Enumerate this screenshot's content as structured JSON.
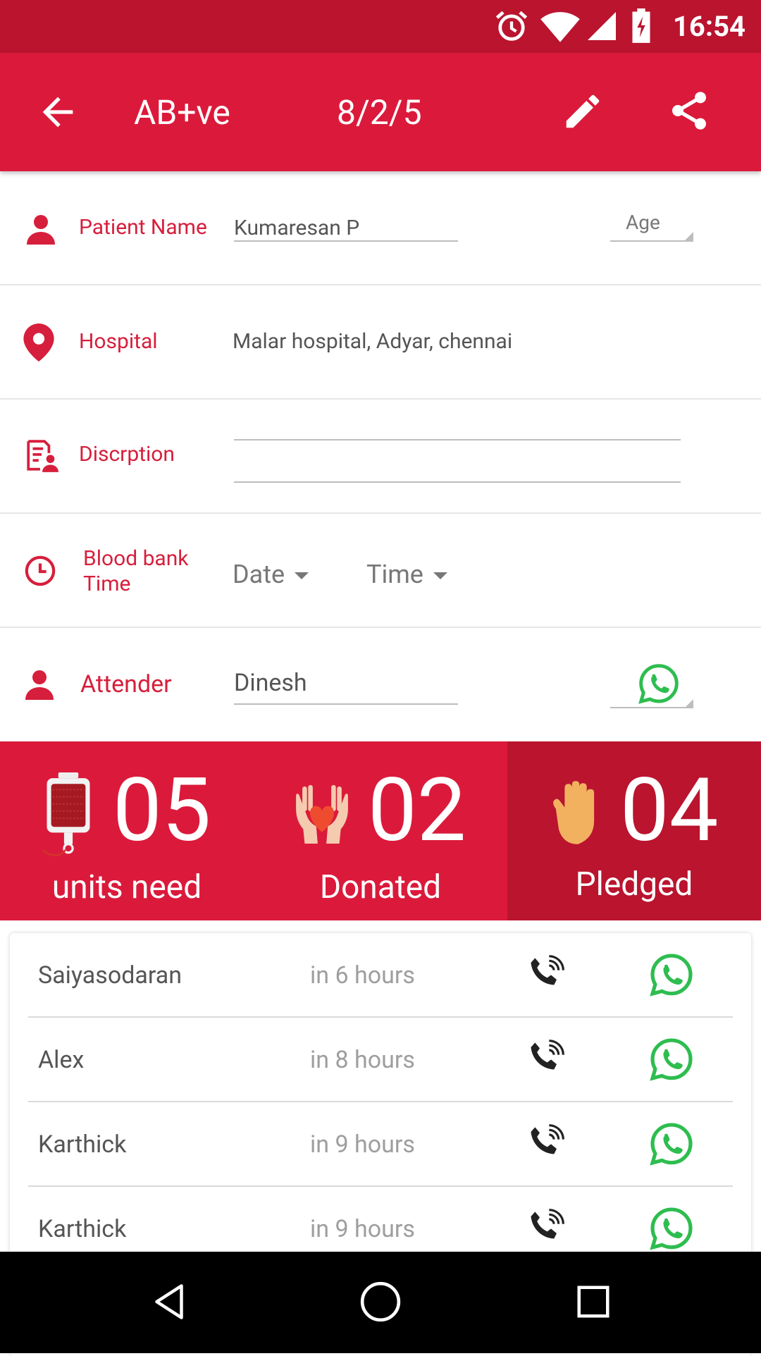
{
  "status_bar": {
    "time": "16:54"
  },
  "app_bar": {
    "title": "AB+ve",
    "subtitle": "8/2/5"
  },
  "form": {
    "patient": {
      "label": "Patient Name",
      "value": "Kumaresan P",
      "age_label": "Age"
    },
    "hospital": {
      "label": "Hospital",
      "value": "Malar hospital, Adyar, chennai"
    },
    "description": {
      "label": "Discrption",
      "value": ""
    },
    "blood_bank": {
      "label_line1": "Blood bank",
      "label_line2": "Time",
      "date_label": "Date",
      "time_label": "Time"
    },
    "attender": {
      "label": "Attender",
      "value": "Dinesh"
    }
  },
  "stats": {
    "needed": {
      "count": "05",
      "label": "units need"
    },
    "donated": {
      "count": "02",
      "label": "Donated"
    },
    "pledged": {
      "count": "04",
      "label": "Pledged"
    }
  },
  "donors": [
    {
      "name": "Saiyasodaran",
      "when": "in 6 hours"
    },
    {
      "name": "Alex",
      "when": "in 8 hours"
    },
    {
      "name": "Karthick",
      "when": "in 9 hours"
    },
    {
      "name": "Karthick",
      "when": "in 9 hours"
    }
  ],
  "colors": {
    "primary": "#db1a3b",
    "primary_dark": "#ba142f",
    "whatsapp": "#2ebd4f"
  },
  "icons": [
    "alarm-icon",
    "wifi-icon",
    "signal-icon",
    "battery-icon",
    "back-arrow-icon",
    "edit-icon",
    "share-icon",
    "person-icon",
    "location-pin-icon",
    "description-icon",
    "clock-icon",
    "whatsapp-icon",
    "blood-bag-icon",
    "heart-hands-icon",
    "raised-hand-icon",
    "phone-icon",
    "nav-back-icon",
    "nav-home-icon",
    "nav-recents-icon"
  ]
}
